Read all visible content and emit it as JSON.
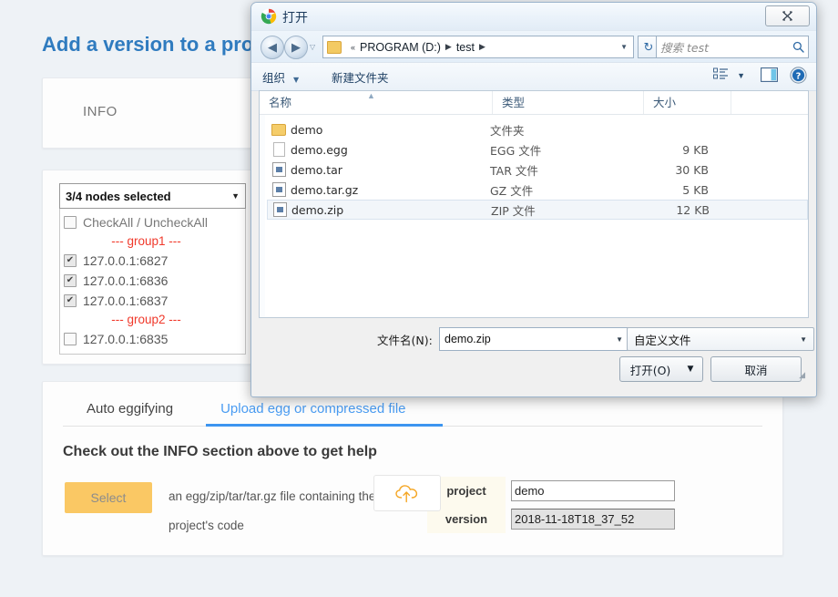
{
  "page": {
    "title": "Add a version to a project",
    "info_panel": {
      "label": "INFO"
    },
    "nodes": {
      "summary": "3/4 nodes selected",
      "caret": "▼",
      "check_all_label": "CheckAll / UnchecAll",
      "check_all_text": "CheckAll / UncheckAll",
      "items": [
        {
          "type": "group",
          "label": "--- group1 ---"
        },
        {
          "type": "node",
          "label": "127.0.0.1:6827",
          "checked": true
        },
        {
          "type": "node",
          "label": "127.0.0.1:6836",
          "checked": true
        },
        {
          "type": "node",
          "label": "127.0.0.1:6837",
          "checked": true
        },
        {
          "type": "group",
          "label": "--- group2 ---"
        },
        {
          "type": "node",
          "label": "127.0.0.1:6835",
          "checked": false
        }
      ]
    },
    "tabs": [
      {
        "label": "Auto eggifying",
        "active": false
      },
      {
        "label": "Upload egg or compressed file",
        "active": true
      }
    ],
    "help_heading": "Check out the INFO section above to get help",
    "select_button": "Select",
    "description_line1": "an egg/zip/tar/tar.gz file containing the",
    "description_line2": "project's code",
    "fields": [
      {
        "key": "project",
        "value": "demo",
        "disabled": false
      },
      {
        "key": "version",
        "value": "2018-11-18T18_37_52",
        "disabled": true
      }
    ],
    "upload_icon": "cloud-upload-icon",
    "colors": {
      "title_blue": "#2f7bbf",
      "tab_active": "#4a9cf2",
      "group_red": "#f0392b",
      "select_amber": "#fac864",
      "upload_orange": "#f5a623"
    }
  },
  "dialog": {
    "title": "打开",
    "app_icon": "chrome-icon",
    "close_label": "✖",
    "nav": {
      "back_icon": "◀",
      "forward_icon": "▶",
      "dropdown_icon": "▼",
      "recent_caret": "▽",
      "breadcrumb": [
        "PROGRAM (D:)",
        "test"
      ],
      "breadcrumb_prefix": "«",
      "breadcrumb_sep": "▶",
      "address_caret": "▼",
      "refresh_icon": "↻",
      "search_placeholder": "搜索 test",
      "search_icon": "⚲"
    },
    "commands": {
      "organize": "组织",
      "organize_caret": "▼",
      "new_folder": "新建文件夹",
      "view_caret": "▼",
      "help_icon": "?"
    },
    "columns": {
      "name": "名称",
      "type": "类型",
      "size": "大小"
    },
    "files": [
      {
        "name": "demo",
        "type": "文件夹",
        "size": "",
        "icon": "folder-icon",
        "selected": false
      },
      {
        "name": "demo.egg",
        "type": "EGG 文件",
        "size": "9 KB",
        "icon": "file-icon",
        "selected": false
      },
      {
        "name": "demo.tar",
        "type": "TAR 文件",
        "size": "30 KB",
        "icon": "archive-icon",
        "selected": false
      },
      {
        "name": "demo.tar.gz",
        "type": "GZ 文件",
        "size": "5 KB",
        "icon": "archive-icon",
        "selected": false
      },
      {
        "name": "demo.zip",
        "type": "ZIP 文件",
        "size": "12 KB",
        "icon": "archive-icon",
        "selected": true
      }
    ],
    "filename_label": "文件名(N):",
    "filename_value": "demo.zip",
    "filetype_value": "自定义文件",
    "open_button": "打开(O)",
    "open_caret": "▼",
    "cancel_button": "取消",
    "combo_caret": "▼"
  }
}
